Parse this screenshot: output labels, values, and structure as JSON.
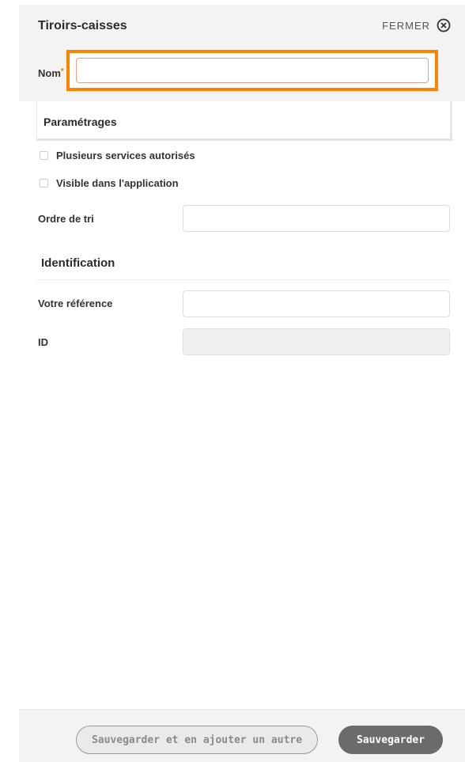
{
  "header": {
    "title": "Tiroirs-caisses",
    "close_label": "FERMER",
    "name_label": "Nom",
    "name_required_mark": "*",
    "name_value": ""
  },
  "settings": {
    "title": "Paramétrages",
    "checkboxes": [
      {
        "label": "Plusieurs services autorisés",
        "checked": false
      },
      {
        "label": "Visible dans l'application",
        "checked": false
      }
    ],
    "sort_order_label": "Ordre de tri",
    "sort_order_value": ""
  },
  "identification": {
    "title": "Identification",
    "reference_label": "Votre référence",
    "reference_value": "",
    "id_label": "ID",
    "id_value": ""
  },
  "footer": {
    "save_and_add_label": "Sauvegarder et en ajouter un autre",
    "save_label": "Sauvegarder"
  },
  "colors": {
    "highlight": "#ff8200",
    "header_bg": "#f3f3f3",
    "primary_button": "#6b6b6b"
  }
}
